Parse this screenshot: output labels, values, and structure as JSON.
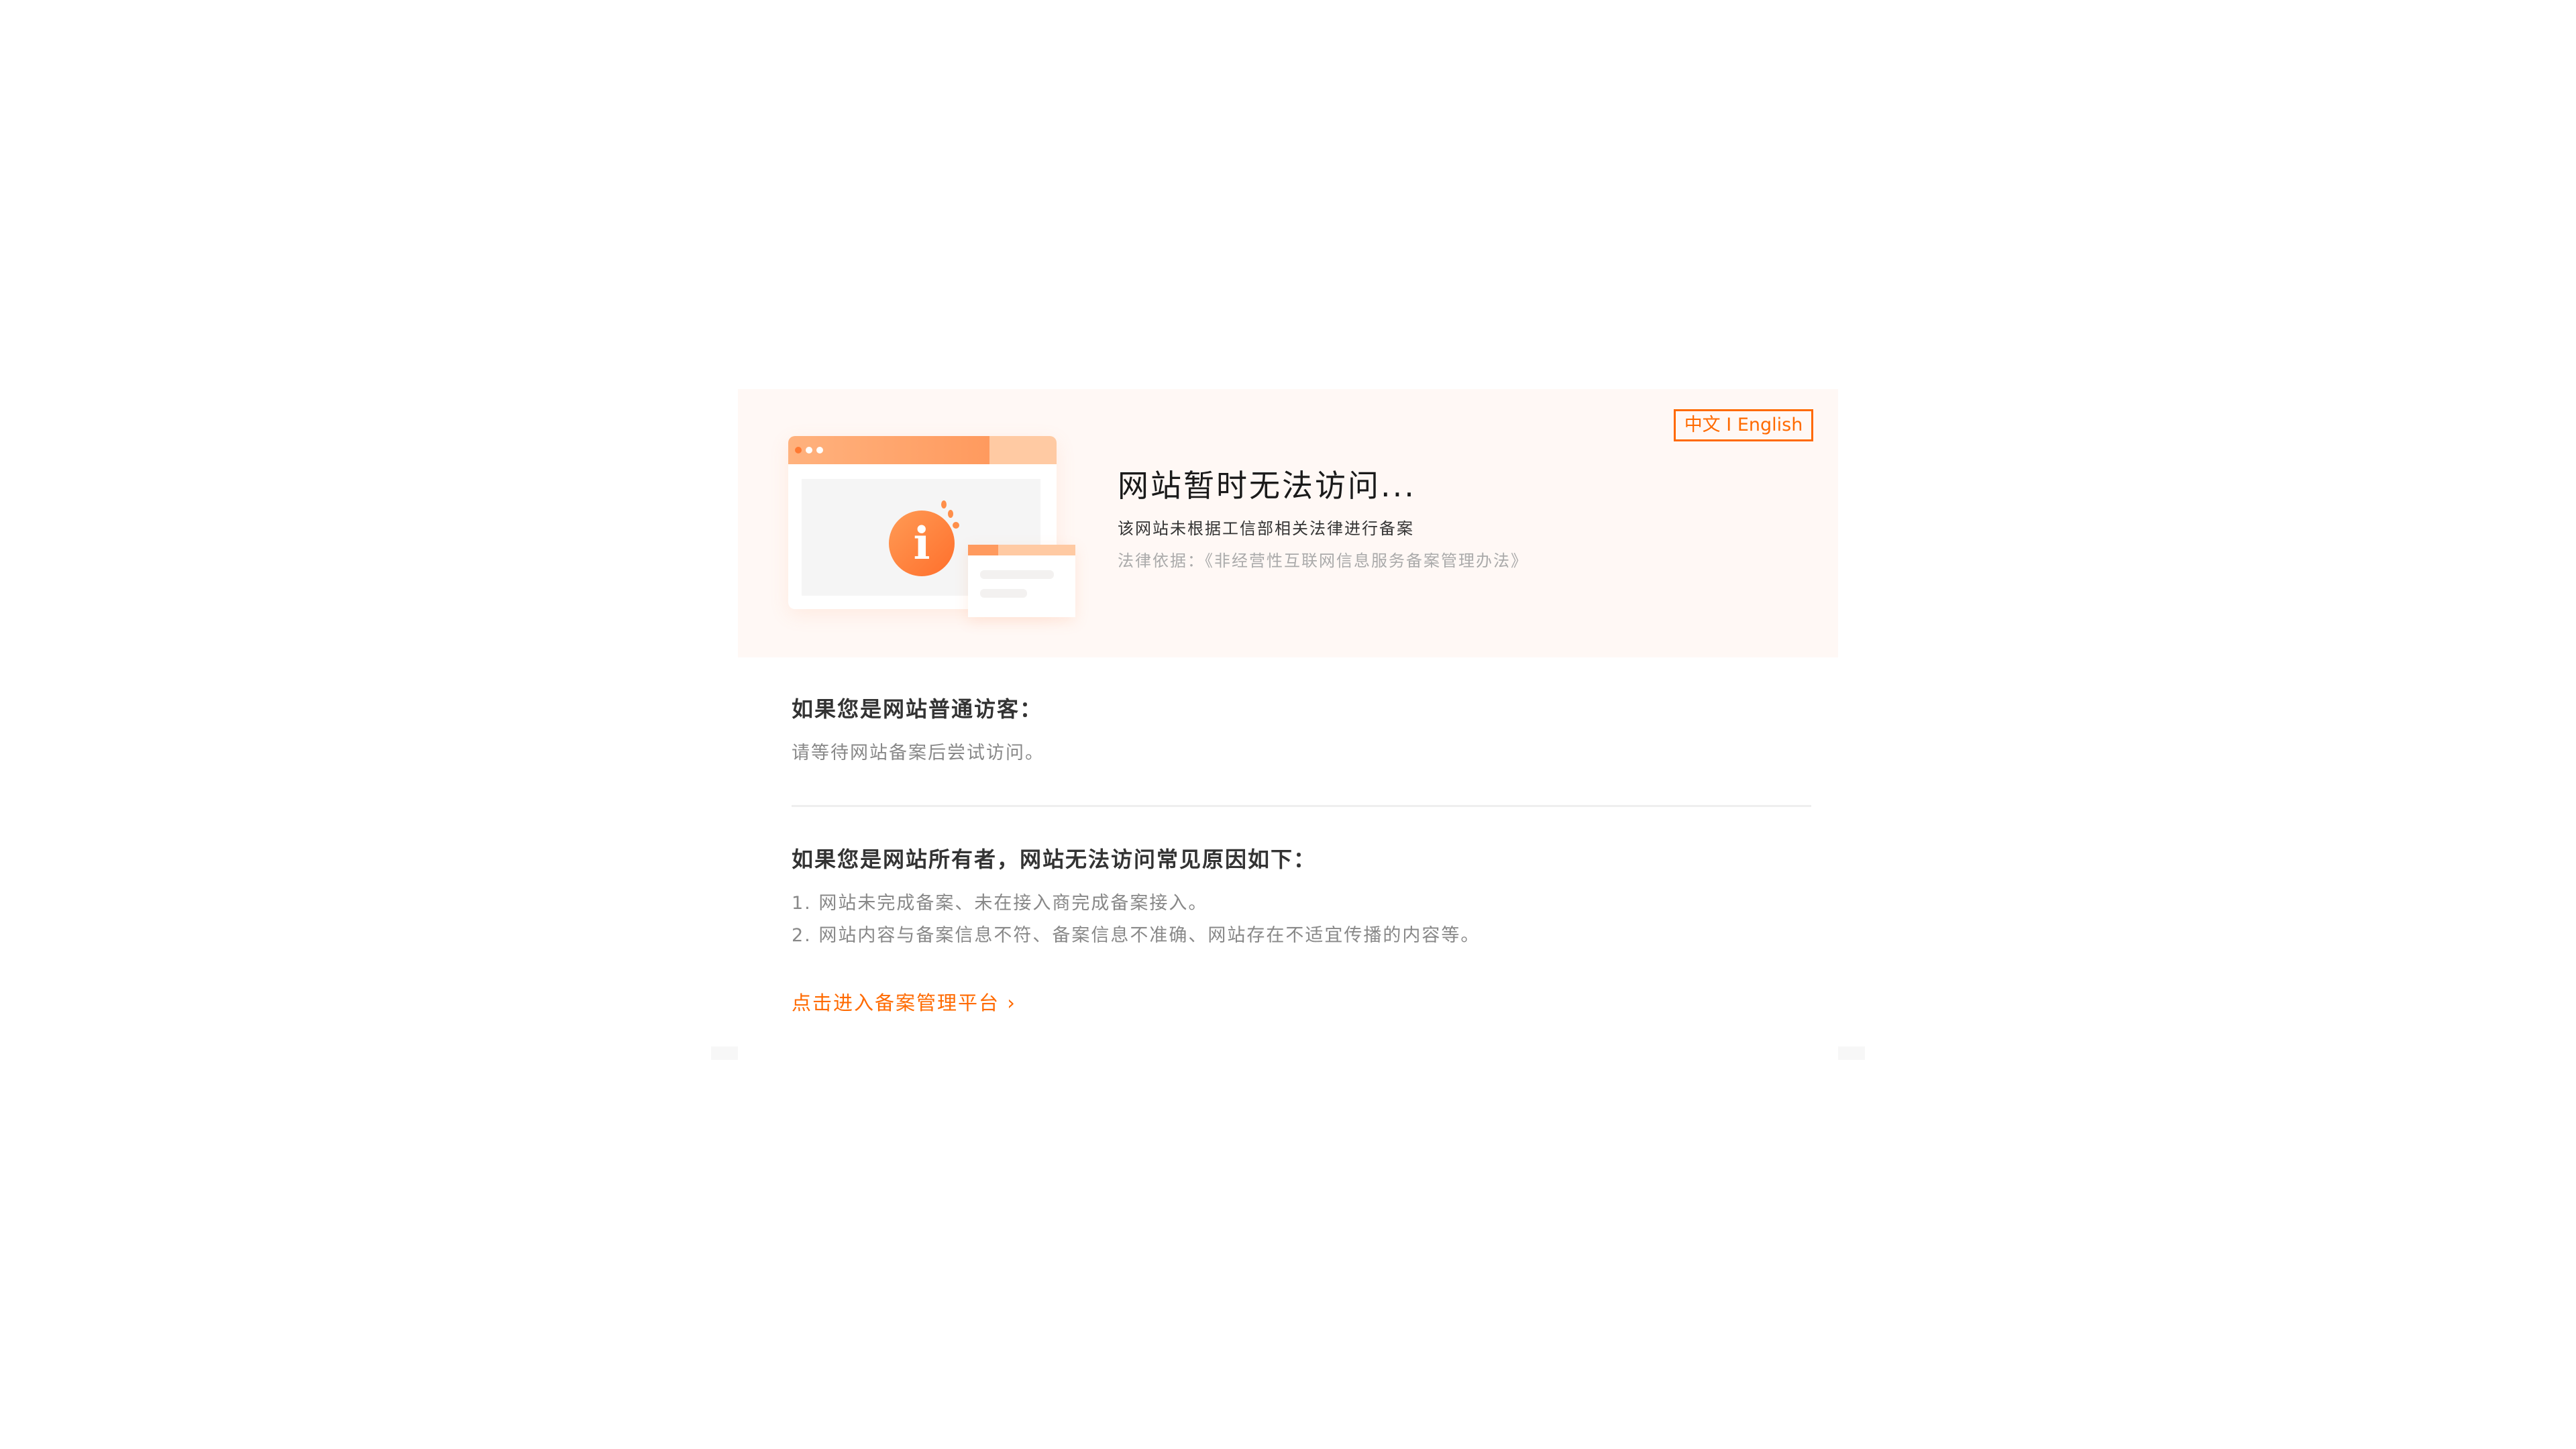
{
  "header": {
    "language_switch": "中文 I English",
    "title": "网站暂时无法访问...",
    "description": "该网站未根据工信部相关法律进行备案",
    "legal_basis": "法律依据：《非经营性互联网信息服务备案管理办法》"
  },
  "visitor": {
    "heading": "如果您是网站普通访客：",
    "text": "请等待网站备案后尝试访问。"
  },
  "owner": {
    "heading": "如果您是网站所有者，网站无法访问常见原因如下：",
    "reasons": [
      "1. 网站未完成备案、未在接入商完成备案接入。",
      "2. 网站内容与备案信息不符、备案信息不准确、网站存在不适宜传播的内容等。"
    ]
  },
  "link": {
    "label": "点击进入备案管理平台",
    "icon": "chevron-right-icon",
    "glyph": "›"
  },
  "colors": {
    "accent": "#ff6a00",
    "header_bg": "#fff8f5"
  }
}
